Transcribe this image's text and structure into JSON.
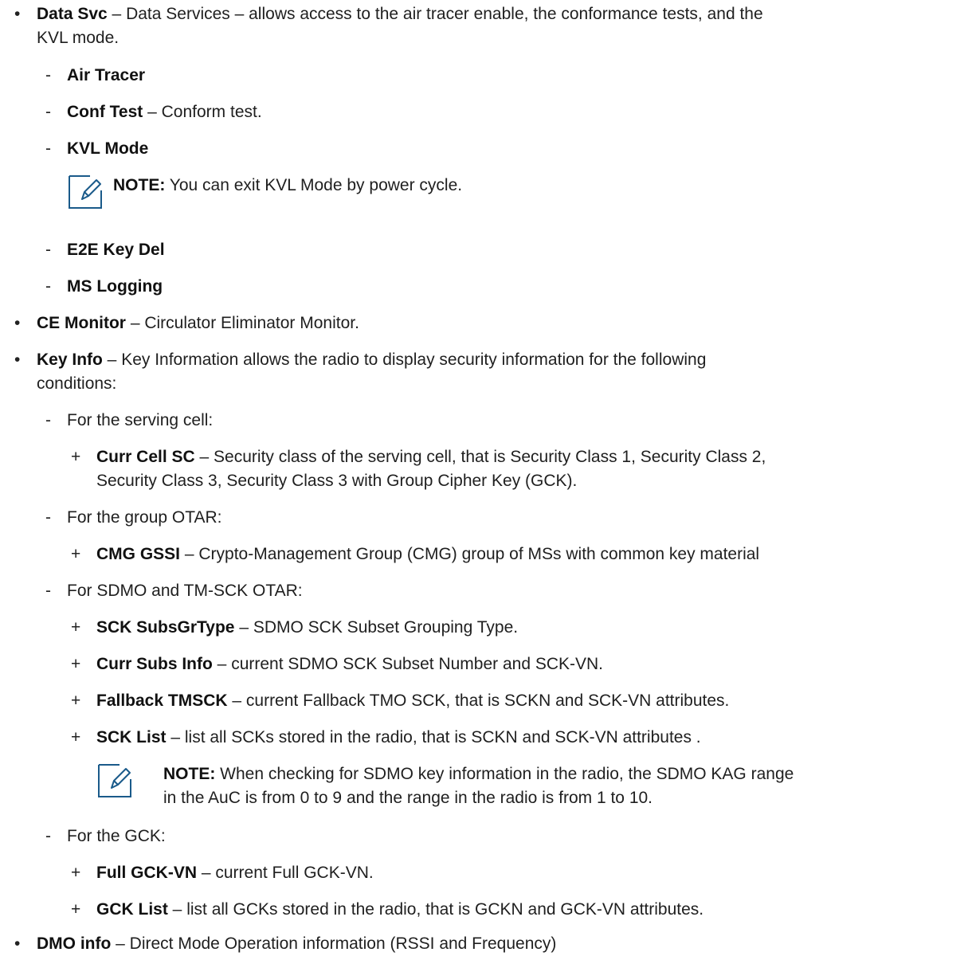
{
  "bullets": {
    "data_svc": {
      "term": "Data Svc",
      "desc_line1": " – Data Services – allows access to the air tracer enable, the conformance tests, and the",
      "desc_line2": "KVL mode.",
      "subitems": [
        {
          "term": "Air Tracer",
          "desc": ""
        },
        {
          "term": "Conf Test",
          "desc": " – Conform test."
        },
        {
          "term": "KVL Mode",
          "desc": ""
        }
      ],
      "note": {
        "label": "NOTE:",
        "text": " You can exit KVL Mode by power cycle."
      },
      "subitems2": [
        {
          "term": "E2E Key Del"
        },
        {
          "term": "MS Logging"
        }
      ]
    },
    "ce_monitor": {
      "term": "CE Monitor",
      "desc": " – Circulator Eliminator Monitor."
    },
    "key_info": {
      "term": "Key Info",
      "desc_line1": " – Key Information allows the radio to display security information for the following",
      "desc_line2": "conditions:",
      "serving_cell": {
        "label": "For the serving cell:",
        "item_term": "Curr Cell SC",
        "item_desc_line1": " – Security class of the serving cell, that is Security Class 1, Security Class 2,",
        "item_desc_line2": "Security Class 3, Security Class 3 with Group Cipher Key (GCK)."
      },
      "group_otar": {
        "label": "For the group OTAR:",
        "item_term": "CMG GSSI",
        "item_desc": " – Crypto-Management Group (CMG) group of MSs with common key material"
      },
      "sdmo": {
        "label": "For SDMO and TM-SCK OTAR:",
        "items": [
          {
            "term": "SCK SubsGrType",
            "desc": " – SDMO SCK Subset Grouping Type."
          },
          {
            "term": "Curr Subs Info",
            "desc": " – current SDMO SCK Subset Number and SCK-VN."
          },
          {
            "term": "Fallback TMSCK",
            "desc": " – current Fallback TMO SCK, that is SCKN and SCK-VN attributes."
          },
          {
            "term": "SCK List",
            "desc": " – list all SCKs stored in the radio, that is SCKN and SCK-VN attributes ."
          }
        ],
        "note": {
          "label": "NOTE:",
          "text_line1": " When checking for SDMO key information in the radio, the SDMO KAG range",
          "text_line2": "in the AuC is from 0 to 9 and the range in the radio is from 1 to 10."
        }
      },
      "gck": {
        "label": "For the GCK:",
        "items": [
          {
            "term": "Full GCK-VN",
            "desc": " – current Full GCK-VN."
          },
          {
            "term": "GCK List",
            "desc": " – list all GCKs stored in the radio, that is GCKN and GCK-VN attributes."
          }
        ]
      }
    },
    "dmo_info": {
      "term": "DMO info",
      "desc": " – Direct Mode Operation information (RSSI and Frequency)"
    }
  },
  "markers": {
    "bullet": "•",
    "dash": "-",
    "plus": "+"
  },
  "icons": {
    "note": "note-pencil-icon"
  },
  "colors": {
    "icon": "#1a5a8a",
    "text": "#1f1f1f"
  }
}
